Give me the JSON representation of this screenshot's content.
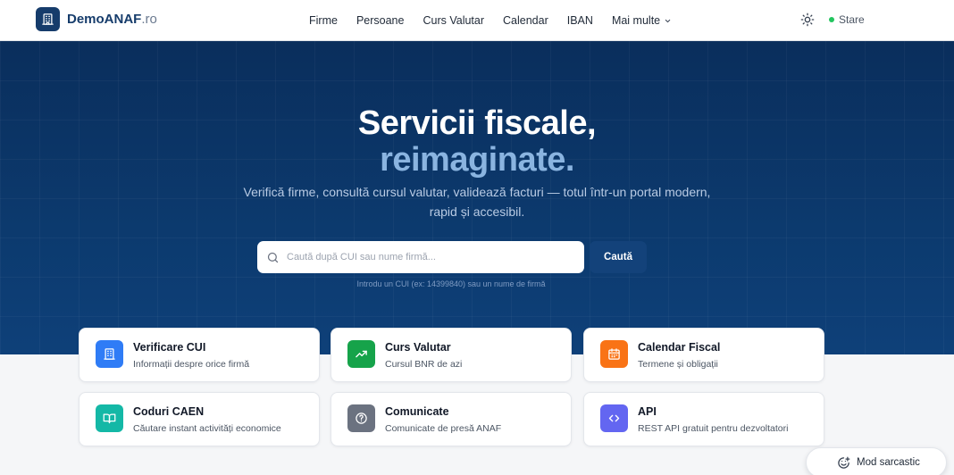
{
  "header": {
    "brand": "DemoANAF",
    "brand_tld": ".ro",
    "nav": [
      "Firme",
      "Persoane",
      "Curs Valutar",
      "Calendar",
      "IBAN",
      "Mai multe"
    ],
    "status_label": "Stare"
  },
  "hero": {
    "title_line1": "Servicii fiscale,",
    "title_line2": "reimaginate.",
    "subtitle": "Verifică firme, consultă cursul valutar, validează facturi — totul într-un portal modern, rapid și accesibil.",
    "search_placeholder": "Caută după CUI sau nume firmă...",
    "search_button": "Caută",
    "search_hint": "Introdu un CUI (ex: 14399840) sau un nume de firmă"
  },
  "cards": [
    {
      "title": "Verificare CUI",
      "desc": "Informații despre orice firmă",
      "icon": "building-icon",
      "color": "#2f7cf6"
    },
    {
      "title": "Curs Valutar",
      "desc": "Cursul BNR de azi",
      "icon": "trending-up-icon",
      "color": "#16a34a"
    },
    {
      "title": "Calendar Fiscal",
      "desc": "Termene și obligații",
      "icon": "calendar-icon",
      "color": "#f97316"
    },
    {
      "title": "Coduri CAEN",
      "desc": "Căutare instant activități economice",
      "icon": "book-open-icon",
      "color": "#14b8a6"
    },
    {
      "title": "Comunicate",
      "desc": "Comunicate de presă ANAF",
      "icon": "help-circle-icon",
      "color": "#6b7280"
    },
    {
      "title": "API",
      "desc": "REST API gratuit pentru dezvoltatori",
      "icon": "code-icon",
      "color": "#6366f1"
    }
  ],
  "sarcasm_label": "Mod sarcastic",
  "colors": {
    "brand": "#163c6b",
    "hero_bg": "#0c3a6e",
    "hero_accent": "#8ab4e0",
    "status_ok": "#22c55e"
  }
}
